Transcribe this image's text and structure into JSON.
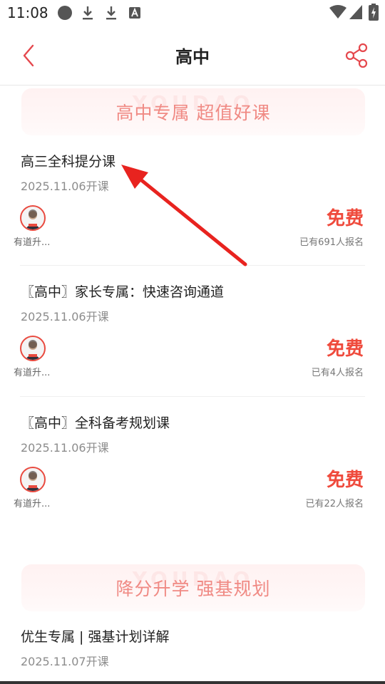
{
  "status_bar": {
    "time": "11:08",
    "icons": [
      "record-dot-icon",
      "download-icon",
      "download-icon",
      "font-icon",
      "wifi-icon",
      "signal-icon",
      "battery-icon"
    ]
  },
  "header": {
    "title": "高中",
    "back_icon": "chevron-left-icon",
    "share_icon": "share-icon"
  },
  "sections": [
    {
      "banner_title": "高中专属 超值好课",
      "banner_watermark": "YOUDAO",
      "courses": [
        {
          "title": "高三全科提分课",
          "date": "2025.11.06开课",
          "teacher": "有道升...",
          "price": "免费",
          "enrolled": "已有691人报名"
        },
        {
          "title": "〖高中〗家长专属：快速咨询通道",
          "date": "2025.11.06开课",
          "teacher": "有道升...",
          "price": "免费",
          "enrolled": "已有4人报名"
        },
        {
          "title": "〖高中〗全科备考规划课",
          "date": "2025.11.06开课",
          "teacher": "有道升...",
          "price": "免费",
          "enrolled": "已有22人报名"
        }
      ]
    },
    {
      "banner_title": "降分升学 强基规划",
      "banner_watermark": "YOUDAO",
      "courses": [
        {
          "title": "优生专属 | 强基计划详解",
          "date": "2025.11.07开课"
        }
      ]
    }
  ],
  "colors": {
    "accent_red": "#ef4a3c",
    "banner_text": "#f08a84",
    "annotation_arrow": "#e8231f"
  }
}
